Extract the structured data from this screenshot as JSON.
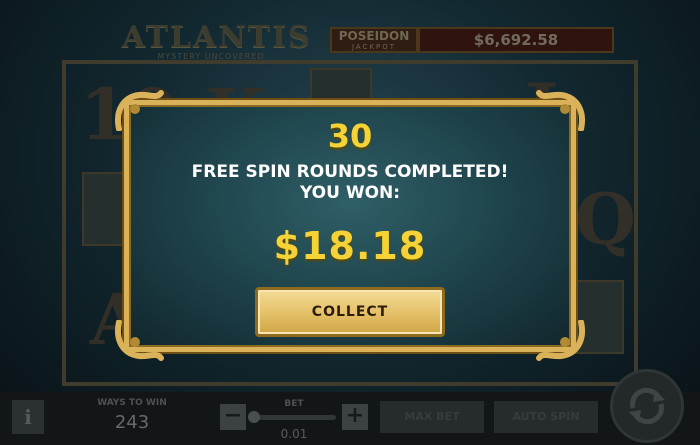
{
  "header": {
    "logo_title": "ATLANTIS",
    "logo_subtitle": "MYSTERY UNCOVERED",
    "jackpot_name": "POSEIDON",
    "jackpot_sub": "JACKPOT",
    "jackpot_value": "$6,692.58"
  },
  "reels": {
    "visible_symbols": [
      "10",
      "K",
      "A",
      "A",
      "Q",
      "J"
    ]
  },
  "bottom_bar": {
    "info_label": "i",
    "ways_label": "WAYS TO WIN",
    "ways_value": "243",
    "minus_label": "−",
    "plus_label": "+",
    "bet_label": "BET",
    "bet_value": "0.01",
    "max_bet_label": "MAX BET",
    "auto_spin_label": "AUTO SPIN"
  },
  "modal": {
    "count": "30",
    "line1": "FREE SPIN ROUNDS COMPLETED!",
    "line2": "YOU WON:",
    "amount": "$18.18",
    "collect_label": "COLLECT"
  },
  "colors": {
    "gold_text": "#f5d235",
    "frame_gold": "#d9b25a",
    "modal_teal": "#1d4048"
  }
}
